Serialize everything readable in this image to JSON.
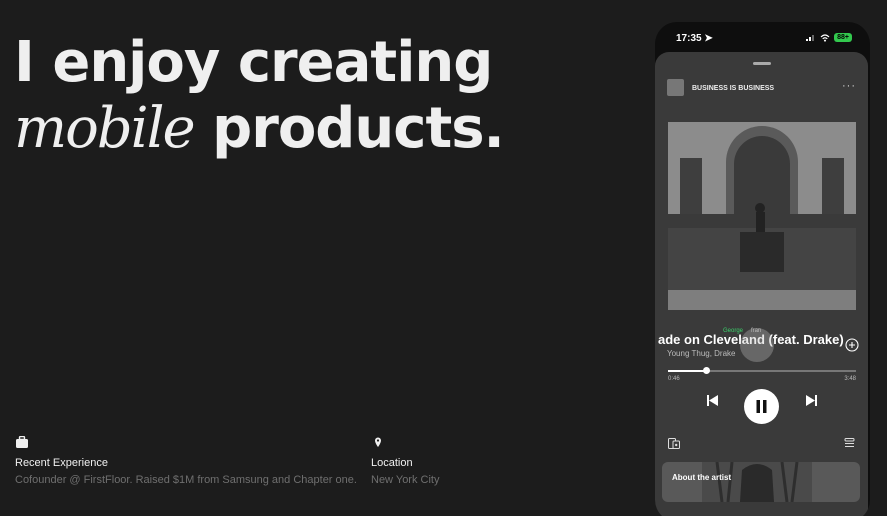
{
  "hero": {
    "line1": "I enjoy creating",
    "italic_word": "mobile",
    "line2_rest": " products."
  },
  "experience": {
    "icon": "briefcase-icon",
    "label": "Recent Experience",
    "value": "Cofounder @ FirstFloor. Raised $1M from Samsung and Chapter one."
  },
  "location": {
    "icon": "map-pin-icon",
    "label": "Location",
    "value": "New York City"
  },
  "phone": {
    "status": {
      "time": "17:35",
      "battery": "88+"
    },
    "playlist_title": "BUSINESS IS BUSINESS",
    "song_title": "ade on Cleveland (feat. Drake)",
    "artist": "Young Thug, Drake",
    "overlay_tag_green": "George",
    "overlay_tag_gray": "fran",
    "progress": 0.2,
    "elapsed": "0:46",
    "duration": "3:48",
    "about_label": "About the artist",
    "accent": "#33c94e"
  }
}
